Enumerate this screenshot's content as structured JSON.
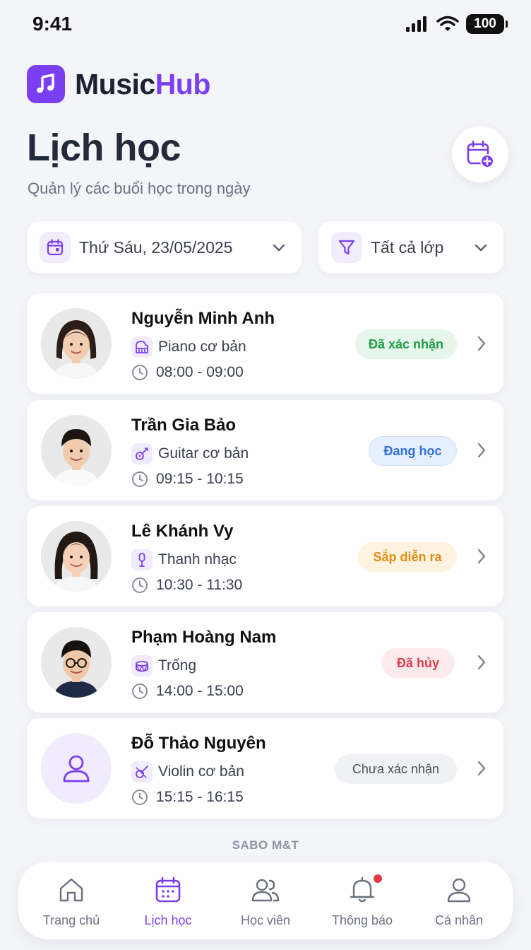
{
  "status_bar": {
    "time": "9:41",
    "battery": "100"
  },
  "brand": {
    "name_part1": "Music",
    "name_part2": "Hub",
    "accent": "#7a3ff2"
  },
  "header": {
    "title": "Lịch học",
    "subtitle": "Quản lý các buổi học trong ngày",
    "add_icon": "calendar-plus-icon"
  },
  "filters": {
    "date": {
      "value": "Thứ Sáu, 23/05/2025",
      "icon": "calendar-icon"
    },
    "class": {
      "value": "Tất cả lớp",
      "icon": "filter-icon"
    }
  },
  "lessons": [
    {
      "student": "Nguyễn Minh Anh",
      "course": "Piano cơ bản",
      "course_icon": "piano-icon",
      "time": "08:00 - 09:00",
      "status": "Đã xác nhận",
      "status_color": "#1f9d45",
      "status_bg": "#e6f6ea"
    },
    {
      "student": "Trần Gia Bảo",
      "course": "Guitar cơ bản",
      "course_icon": "guitar-icon",
      "time": "09:15 - 10:15",
      "status": "Đang học",
      "status_color": "#2f6fe0",
      "status_bg": "#e6effd"
    },
    {
      "student": "Lê Khánh Vy",
      "course": "Thanh nhạc",
      "course_icon": "microphone-icon",
      "time": "10:30 - 11:30",
      "status": "Sắp diễn ra",
      "status_color": "#e58a12",
      "status_bg": "#fff3e0"
    },
    {
      "student": "Phạm Hoàng Nam",
      "course": "Trống",
      "course_icon": "drum-icon",
      "time": "14:00 - 15:00",
      "status": "Đã hủy",
      "status_color": "#e03c4c",
      "status_bg": "#fdeaec"
    },
    {
      "student": "Đỗ Thảo Nguyên",
      "course": "Violin cơ bản",
      "course_icon": "violin-icon",
      "time": "15:15 - 16:15",
      "status": "Chưa xác nhận",
      "status_color": "#4a4f5e",
      "status_bg": "#f0f1f4"
    }
  ],
  "footer": {
    "brand": "SABO M&T"
  },
  "tabs": [
    {
      "label": "Trang chủ",
      "icon": "home-icon"
    },
    {
      "label": "Lịch học",
      "icon": "calendar-icon",
      "active": true
    },
    {
      "label": "Học viên",
      "icon": "users-icon"
    },
    {
      "label": "Thông báo",
      "icon": "bell-icon",
      "has_notification": true
    },
    {
      "label": "Cá nhân",
      "icon": "user-icon"
    }
  ]
}
